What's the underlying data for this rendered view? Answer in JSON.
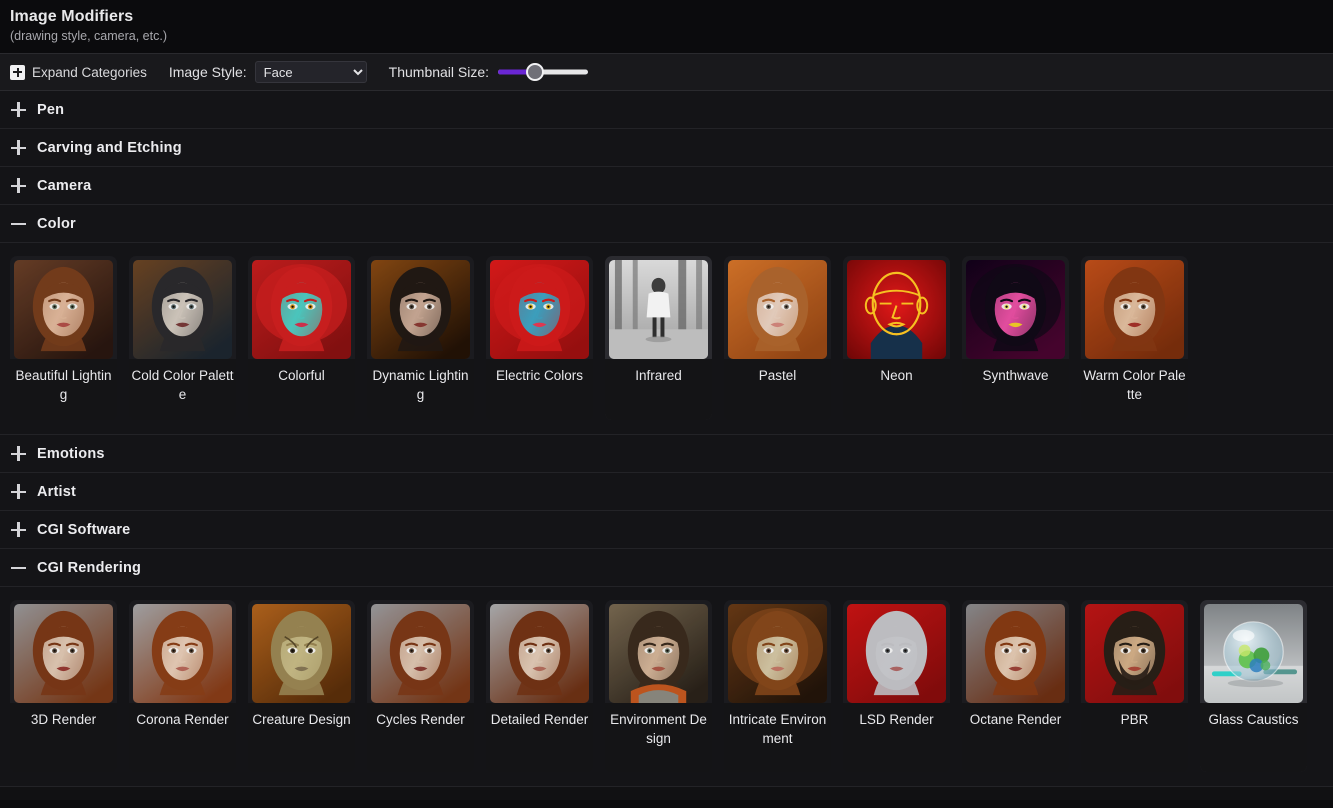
{
  "header": {
    "title": "Image Modifiers",
    "subtitle": "(drawing style, camera, etc.)"
  },
  "toolbar": {
    "expand_categories_label": "Expand Categories",
    "expand_icon": "plus-square-icon",
    "image_style_label": "Image Style:",
    "image_style_value": "Face",
    "image_style_options": [
      "Face"
    ],
    "thumbnail_size_label": "Thumbnail Size:",
    "thumbnail_size_value": 34,
    "slider_accent": "#6a26d4"
  },
  "categories": [
    {
      "name": "Pen",
      "expanded": false,
      "toggle": "plus-icon",
      "items": []
    },
    {
      "name": "Carving and Etching",
      "expanded": false,
      "toggle": "plus-icon",
      "items": []
    },
    {
      "name": "Camera",
      "expanded": false,
      "toggle": "plus-icon",
      "items": []
    },
    {
      "name": "Color",
      "expanded": true,
      "toggle": "minus-icon",
      "items": [
        {
          "label": "Beautiful Lighting",
          "art": "portrait-warm-brown",
          "light": false
        },
        {
          "label": "Cold Color Palette",
          "art": "portrait-cold-blue",
          "light": false
        },
        {
          "label": "Colorful",
          "art": "portrait-colorful",
          "light": false
        },
        {
          "label": "Dynamic Lighting",
          "art": "portrait-dynamic",
          "light": false
        },
        {
          "label": "Electric Colors",
          "art": "portrait-electric",
          "light": false
        },
        {
          "label": "Infrared",
          "art": "figure-bw-forest",
          "light": true
        },
        {
          "label": "Pastel",
          "art": "portrait-pastel",
          "light": false
        },
        {
          "label": "Neon",
          "art": "neon-outline-face",
          "light": false
        },
        {
          "label": "Synthwave",
          "art": "portrait-synthwave",
          "light": false
        },
        {
          "label": "Warm Color Palette",
          "art": "portrait-warm-orange",
          "light": false
        }
      ]
    },
    {
      "name": "Emotions",
      "expanded": false,
      "toggle": "plus-icon",
      "items": []
    },
    {
      "name": "Artist",
      "expanded": false,
      "toggle": "plus-icon",
      "items": []
    },
    {
      "name": "CGI Software",
      "expanded": false,
      "toggle": "plus-icon",
      "items": []
    },
    {
      "name": "CGI Rendering",
      "expanded": true,
      "toggle": "minus-icon",
      "items": [
        {
          "label": "3D Render",
          "art": "portrait-3d-grey",
          "light": false
        },
        {
          "label": "Corona Render",
          "art": "portrait-corona",
          "light": false
        },
        {
          "label": "Creature Design",
          "art": "creature-face",
          "light": false
        },
        {
          "label": "Cycles Render",
          "art": "portrait-cycles",
          "light": false
        },
        {
          "label": "Detailed Render",
          "art": "portrait-detailed",
          "light": false
        },
        {
          "label": "Environment Design",
          "art": "portrait-environment",
          "light": false
        },
        {
          "label": "Intricate Environment",
          "art": "portrait-intricate",
          "light": false
        },
        {
          "label": "LSD Render",
          "art": "portrait-lsd-red",
          "light": false
        },
        {
          "label": "Octane Render",
          "art": "portrait-octane",
          "light": false
        },
        {
          "label": "PBR",
          "art": "portrait-pbr-beard",
          "light": false
        },
        {
          "label": "Glass Caustics",
          "art": "glass-sphere-marbles",
          "light": true
        }
      ]
    }
  ]
}
